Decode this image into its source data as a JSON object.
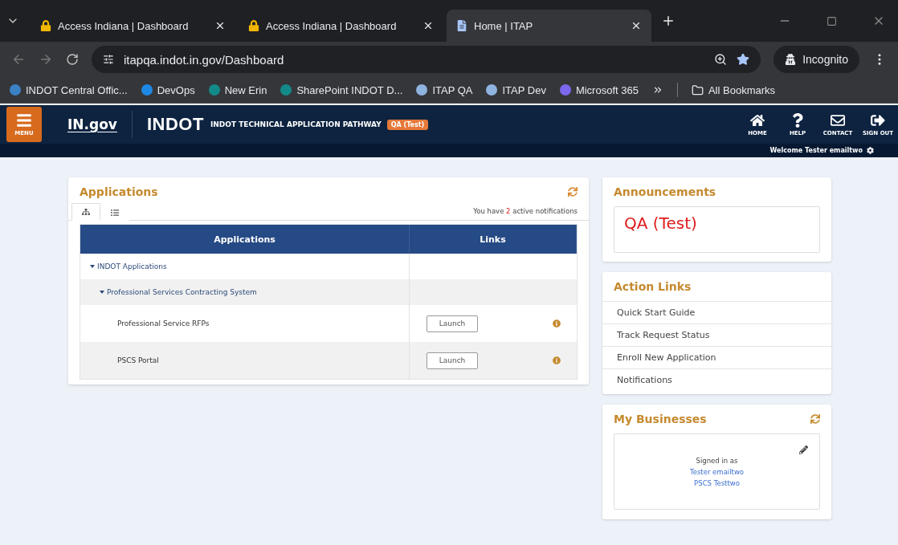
{
  "browser": {
    "tabs": [
      {
        "title": "Access Indiana | Dashboard",
        "kind": "lock",
        "selected": false
      },
      {
        "title": "Access Indiana | Dashboard",
        "kind": "lock",
        "selected": false
      },
      {
        "title": "Home | ITAP",
        "kind": "page",
        "selected": true
      }
    ],
    "url": "itapqa.indot.in.gov/Dashboard",
    "profile": "Incognito",
    "bookmarks": [
      {
        "label": "INDOT Central Offic...",
        "color": "#3b82c4"
      },
      {
        "label": "DevOps",
        "color": "#1e88e5"
      },
      {
        "label": "New Erin",
        "color": "#138a8a"
      },
      {
        "label": "SharePoint INDOT D...",
        "color": "#138a8a"
      },
      {
        "label": "ITAP QA",
        "color": "#90b4e0"
      },
      {
        "label": "ITAP Dev",
        "color": "#90b4e0"
      },
      {
        "label": "Microsoft 365",
        "color": "#7b68ee"
      }
    ],
    "all_bookmarks": "All Bookmarks"
  },
  "site": {
    "menu": "MENU",
    "logo": "IN.gov",
    "agency": "INDOT",
    "app_name": "INDOT TECHNICAL APPLICATION PATHWAY",
    "env_badge": "QA (Test)",
    "nav": [
      {
        "label": "HOME",
        "kind": "home"
      },
      {
        "label": "HELP",
        "kind": "help"
      },
      {
        "label": "CONTACT",
        "kind": "contact"
      },
      {
        "label": "SIGN OUT",
        "kind": "signout"
      }
    ],
    "welcome": "Welcome Tester emailtwo"
  },
  "applications": {
    "title": "Applications",
    "view_tabs": [
      {
        "kind": "tree",
        "selected": true
      },
      {
        "kind": "list",
        "selected": false
      }
    ],
    "notice": {
      "before": "You have",
      "count": "2",
      "after": "active notifications"
    },
    "columns": [
      "Applications",
      "Links"
    ],
    "rows": [
      {
        "name": "INDOT Applications",
        "expanded": true,
        "children": [
          {
            "name": "Professional Services Contracting System",
            "expanded": true,
            "children": [
              {
                "name": "Professional Service RFPs",
                "action": "Launch"
              },
              {
                "name": "PSCS Portal",
                "action": "Launch"
              }
            ]
          }
        ]
      }
    ]
  },
  "announcements": {
    "title": "Announcements",
    "message": "QA (Test)"
  },
  "action_links": {
    "title": "Action Links",
    "items": [
      "Quick Start Guide",
      "Track Request Status",
      "Enroll New Application",
      "Notifications"
    ]
  },
  "my_businesses": {
    "title": "My Businesses",
    "signed_in_label": "Signed in as",
    "user": "Tester emailtwo",
    "business": "PSCS Testtwo"
  }
}
